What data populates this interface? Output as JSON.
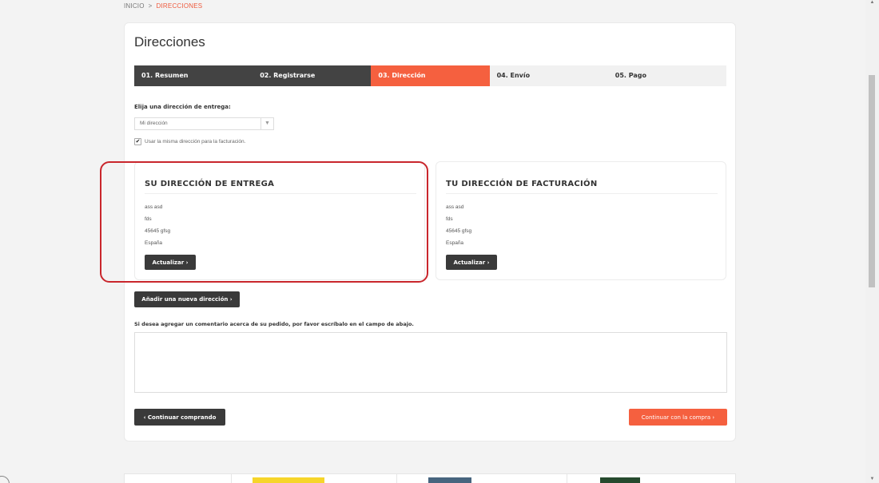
{
  "breadcrumb": {
    "home": "INICIO",
    "separator": ">",
    "current": "DIRECCIONES"
  },
  "page_title": "Direcciones",
  "steps": [
    {
      "label": "01. Resumen",
      "state": "done"
    },
    {
      "label": "02. Registrarse",
      "state": "done"
    },
    {
      "label": "03. Dirección",
      "state": "active"
    },
    {
      "label": "04. Envío",
      "state": "todo"
    },
    {
      "label": "05. Pago",
      "state": "todo"
    }
  ],
  "address_select": {
    "label": "Elija una dirección de entrega:",
    "selected": "Mi dirección"
  },
  "same_address_checkbox": {
    "label": "Usar la misma dirección para la facturación.",
    "checked": true
  },
  "delivery": {
    "title": "SU DIRECCIÓN DE ENTREGA",
    "lines": [
      "ass asd",
      "fds",
      "45645 gfsg",
      "España"
    ],
    "button": "Actualizar"
  },
  "billing": {
    "title": "TU DIRECCIÓN DE FACTURACIÓN",
    "lines": [
      "ass asd",
      "fds",
      "45645 gfsg",
      "España"
    ],
    "button": "Actualizar"
  },
  "add_address_button": "Añadir una nueva dirección",
  "comment": {
    "label": "Si desea agregar un comentario acerca de su pedido, por favor escríbalo en el campo de abajo.",
    "value": ""
  },
  "continue_shopping_button": "Continuar comprando",
  "continue_purchase_button": "Continuar con la compra",
  "colors": {
    "accent": "#f5603f",
    "dark": "#3a3a3a",
    "highlight": "#c9262c"
  }
}
